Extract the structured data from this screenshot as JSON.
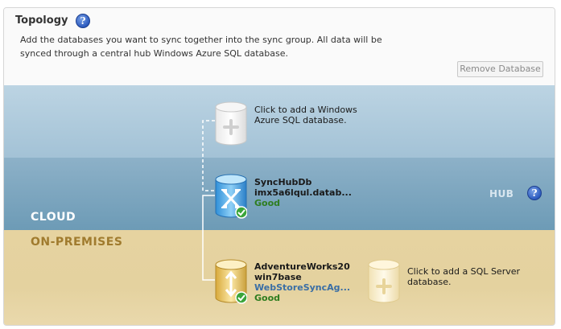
{
  "header": {
    "title": "Topology",
    "description": "Add the databases you want to sync together into the sync group. All data will be synced through a central hub Windows Azure SQL database.",
    "remove_button": "Remove Database"
  },
  "regions": {
    "cloud": "CLOUD",
    "on_premises": "ON-PREMISES",
    "hub": "HUB"
  },
  "azure_add": {
    "label": "Click to add a Windows Azure SQL database."
  },
  "hub_db": {
    "name": "SyncHubDb",
    "server": "imx5a6lqul.datab...",
    "status": "Good"
  },
  "member_db": {
    "name": "AdventureWorks20 win7base",
    "agent": "WebStoreSyncAg...",
    "status": "Good"
  },
  "sql_add": {
    "label": "Click to add a SQL Server database."
  },
  "colors": {
    "cloud": "#a3c2d6",
    "on_premises": "#e6d3a0",
    "status_good": "#2e7d1f",
    "agent_link": "#3a6ea5"
  },
  "icons": {
    "help": "help-icon",
    "azure_add": "database-add-icon",
    "hub": "database-sync-icon",
    "member": "database-sync-icon",
    "status": "check-icon"
  }
}
